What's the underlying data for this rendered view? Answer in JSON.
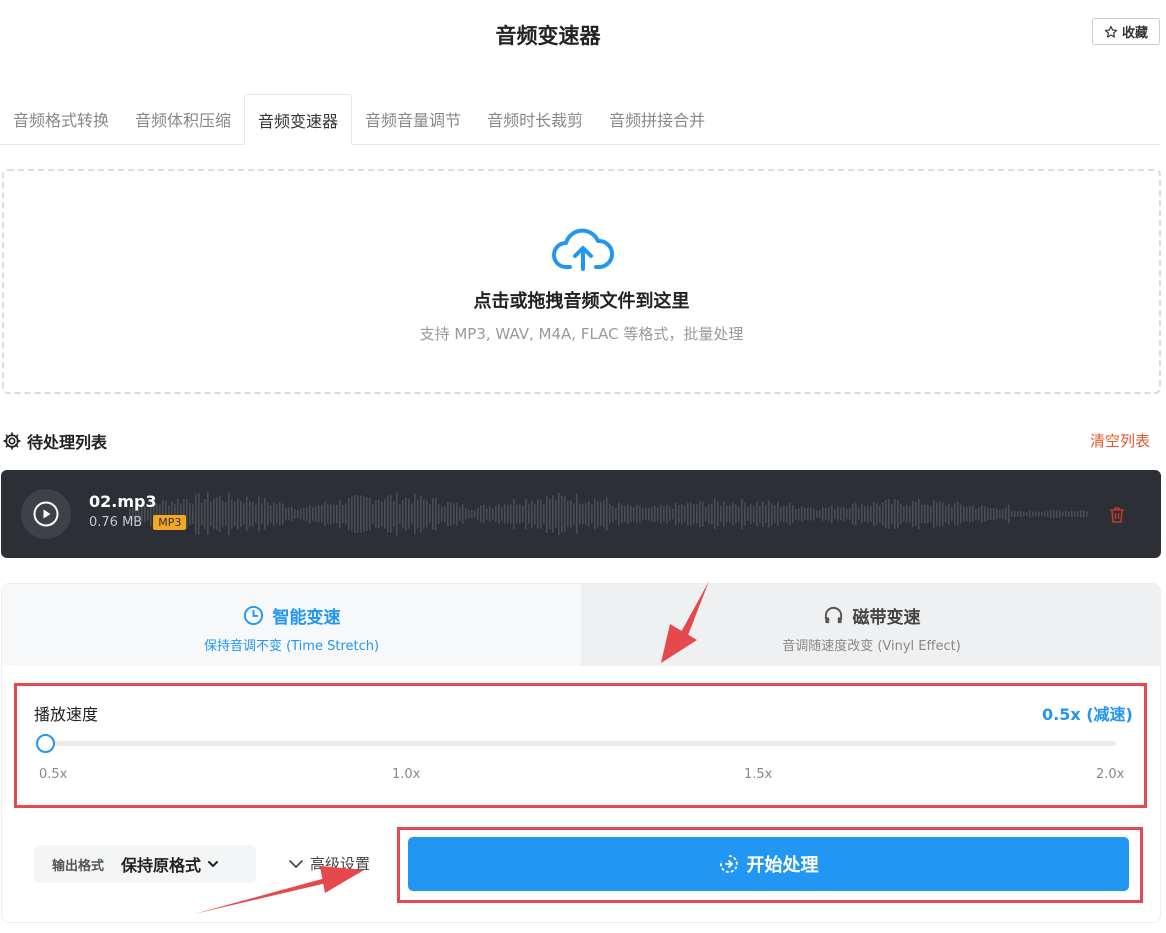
{
  "header": {
    "title": "音频变速器",
    "favorite_label": "收藏"
  },
  "tabs": [
    {
      "label": "音频格式转换",
      "active": false
    },
    {
      "label": "音频体积压缩",
      "active": false
    },
    {
      "label": "音频变速器",
      "active": true
    },
    {
      "label": "音频音量调节",
      "active": false
    },
    {
      "label": "音频时长裁剪",
      "active": false
    },
    {
      "label": "音频拼接合并",
      "active": false
    }
  ],
  "upload": {
    "icon": "cloud-upload-icon",
    "title": "点击或拖拽音频文件到这里",
    "subtitle": "支持 MP3, WAV, M4A, FLAC 等格式，批量处理"
  },
  "queue": {
    "title": "待处理列表",
    "clear_label": "清空列表"
  },
  "file": {
    "name": "02.mp3",
    "size": "0.76 MB",
    "format_badge": "MP3"
  },
  "modes": {
    "smart": {
      "title": "智能变速",
      "subtitle": "保持音调不变 (Time Stretch)",
      "active": true
    },
    "vinyl": {
      "title": "磁带变速",
      "subtitle": "音调随速度改变 (Vinyl Effect)",
      "active": false
    }
  },
  "speed": {
    "label": "播放速度",
    "value_label": "0.5x (减速)",
    "value": 0.5,
    "min": 0.5,
    "max": 2.0,
    "ticks": [
      "0.5x",
      "1.0x",
      "1.5x",
      "2.0x"
    ]
  },
  "output": {
    "label": "输出格式",
    "value": "保持原格式"
  },
  "advanced_label": "高级设置",
  "start_label": "开始处理",
  "colors": {
    "accent": "#2196f3",
    "danger": "#e8562a",
    "annotation": "#e5484d",
    "card_bg": "#2d2f36"
  }
}
